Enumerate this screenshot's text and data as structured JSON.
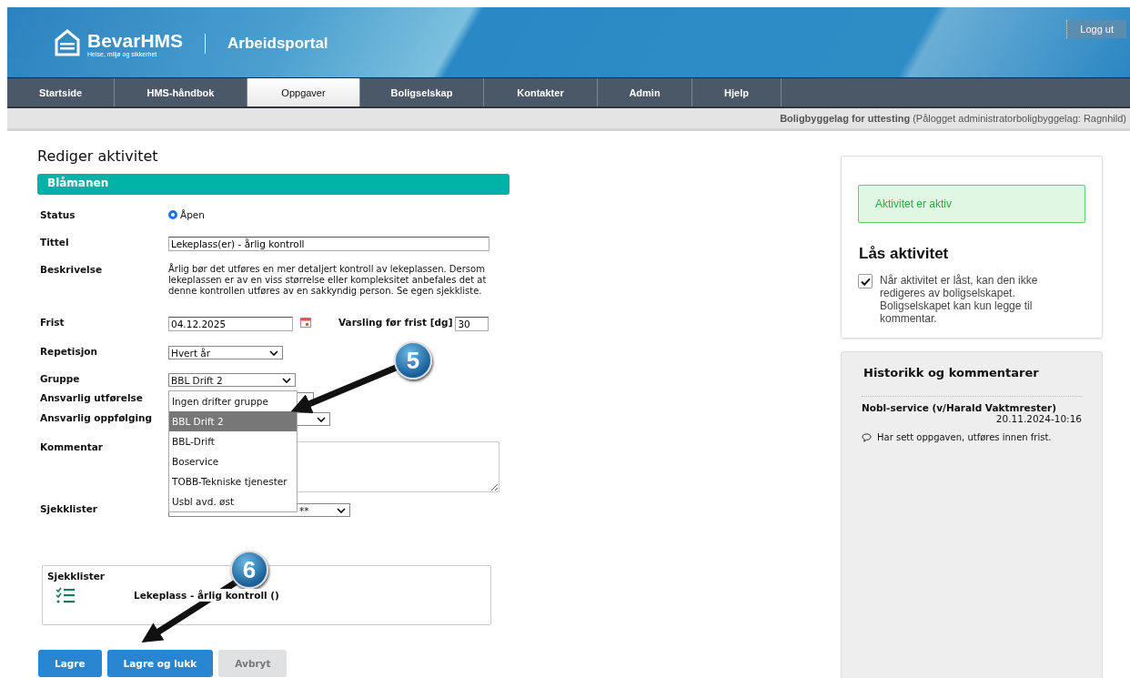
{
  "header": {
    "logo_name": "BevarHMS",
    "logo_tagline": "Helse, miljø og sikkerhet",
    "portal": "Arbeidsportal",
    "logout": "Logg ut"
  },
  "nav": [
    {
      "label": "Startside",
      "selected": false
    },
    {
      "label": "HMS-håndbok",
      "selected": false
    },
    {
      "label": "Oppgaver",
      "selected": true
    },
    {
      "label": "Boligselskap",
      "selected": false
    },
    {
      "label": "Kontakter",
      "selected": false
    },
    {
      "label": "Admin",
      "selected": false
    },
    {
      "label": "Hjelp",
      "selected": false
    }
  ],
  "org_bar": {
    "org": "Boligbyggelag for uttesting",
    "user": "(Pålogget administratorboligbyggelag: Ragnhild)"
  },
  "page_title": "Rediger aktivitet",
  "section_title": "Blåmanen",
  "form": {
    "status": {
      "label": "Status",
      "option": "Åpen",
      "selected": true
    },
    "title": {
      "label": "Tittel",
      "value": "Lekeplass(er) - årlig kontroll"
    },
    "description": {
      "label": "Beskrivelse",
      "text": "Årlig bør det utføres en mer detaljert kontroll av lekeplassen. Dersom lekeplassen er av en viss størrelse eller kompleksitet anbefales det at denne kontrollen utføres av en sakkyndig person. Se egen sjekkliste."
    },
    "deadline": {
      "label": "Frist",
      "value": "04.12.2025",
      "notice_label": "Varsling før frist [dg]",
      "notice_value": "30"
    },
    "repetition": {
      "label": "Repetisjon",
      "value": "Hvert år"
    },
    "group": {
      "label": "Gruppe",
      "value": "BBL Drift 2",
      "options": [
        {
          "label": "Ingen drifter gruppe",
          "selected": false
        },
        {
          "label": "BBL Drift 2",
          "selected": true
        },
        {
          "label": "BBL-Drift",
          "selected": false
        },
        {
          "label": "Boservice",
          "selected": false
        },
        {
          "label": "TOBB-Tekniske tjenester",
          "selected": false
        },
        {
          "label": "Usbl avd. øst",
          "selected": false
        }
      ]
    },
    "responsible_exec": {
      "label": "Ansvarlig utførelse"
    },
    "responsible_follow": {
      "label": "Ansvarlig oppfølging"
    },
    "comment": {
      "label": "Kommentar"
    },
    "checklists": {
      "label": "Sjekklister",
      "value": "**"
    }
  },
  "checklist_box": {
    "title": "Sjekklister",
    "items": [
      "Lekeplass - årlig kontroll ()"
    ]
  },
  "buttons": [
    {
      "label": "Lagre",
      "kind": "primary"
    },
    {
      "label": "Lagre og lukk",
      "kind": "primary"
    },
    {
      "label": "Avbryt",
      "kind": "disabled"
    }
  ],
  "status_panel": {
    "message": "Aktivitet er aktiv",
    "lock_title": "Lås aktivitet",
    "lock_checked": true,
    "lock_text": "Når aktivitet er låst, kan den ikke redigeres av boligselskapet. Boligselskapet kan kun legge til kommentar."
  },
  "history": {
    "title": "Historikk og kommentarer",
    "entries": [
      {
        "author": "Nobl-service (v/Harald Vaktmrester)",
        "time": "20.11.2024-10:16",
        "comment": "Har sett oppgaven, utføres innen frist."
      }
    ]
  },
  "annotations": [
    {
      "number": "5"
    },
    {
      "number": "6"
    }
  ]
}
